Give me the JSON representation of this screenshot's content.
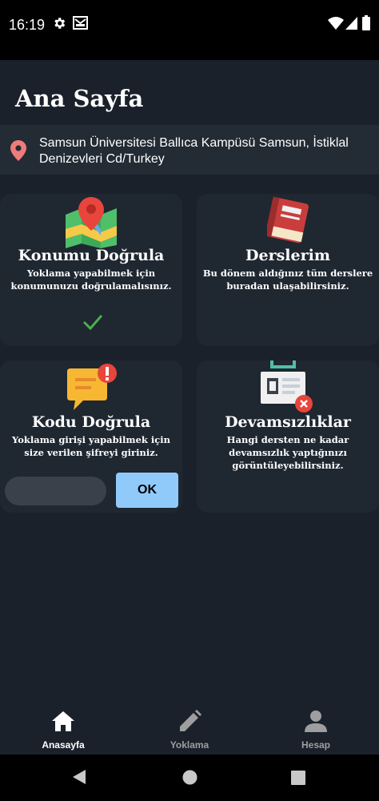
{
  "status_bar": {
    "time": "16:19",
    "icons": [
      "settings-icon",
      "mail-icon",
      "wifi-icon",
      "signal-icon",
      "battery-icon"
    ]
  },
  "header": {
    "title": "Ana Sayfa"
  },
  "location": {
    "icon": "location-pin-icon",
    "address": "Samsun Üniversitesi Ballıca Kampüsü Samsun, İstiklal Denizevleri Cd/Turkey"
  },
  "cards": {
    "verify_location": {
      "icon": "map-pin-icon",
      "title": "Konumu Doğrula",
      "description": "Yoklama yapabilmek için konumunuzu doğrulamalısınız.",
      "status_icon": "check-icon"
    },
    "courses": {
      "icon": "book-icon",
      "title": "Derslerim",
      "description": "Bu dönem aldığınız tüm derslere buradan ulaşabilirsiniz."
    },
    "verify_code": {
      "icon": "message-alert-icon",
      "title": "Kodu Doğrula",
      "description": "Yoklama girişi yapabilmek için size verilen şifreyi giriniz.",
      "input_value": "",
      "button_label": "OK"
    },
    "absences": {
      "icon": "id-card-icon",
      "title": "Devamsızlıklar",
      "description": "Hangi dersten ne kadar devamsızlık yaptığınızı görüntüleyebilirsiniz."
    }
  },
  "bottom_nav": {
    "items": [
      {
        "label": "Anasayfa",
        "icon": "home-icon",
        "active": true
      },
      {
        "label": "Yoklama",
        "icon": "pencil-icon",
        "active": false
      },
      {
        "label": "Hesap",
        "icon": "person-icon",
        "active": false
      }
    ]
  },
  "colors": {
    "background": "#1a212b",
    "card": "#1f2731",
    "accent_button": "#90cafb",
    "check": "#4caf50",
    "nav_active": "#ffffff",
    "nav_inactive": "#9e9e9e"
  }
}
